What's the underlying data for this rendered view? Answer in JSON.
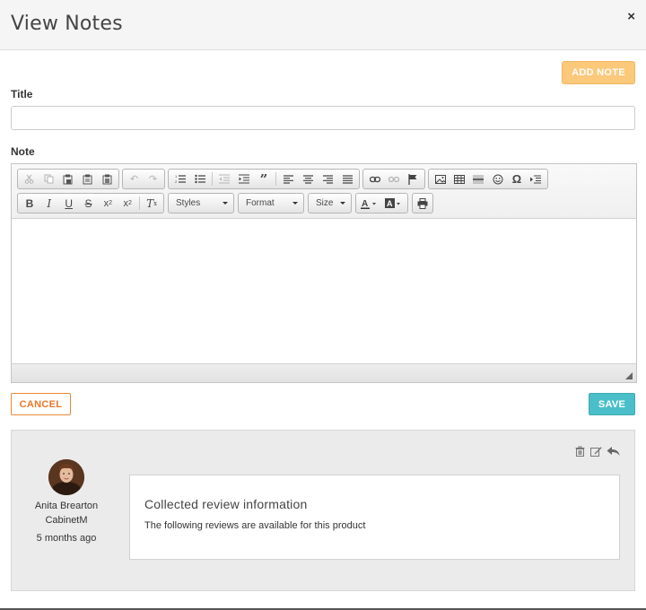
{
  "header": {
    "title": "View Notes",
    "close_glyph": "×"
  },
  "actions": {
    "add_note_label": "ADD NOTE",
    "cancel_label": "CANCEL",
    "save_label": "SAVE"
  },
  "form": {
    "title_label": "Title",
    "title_value": "",
    "note_label": "Note"
  },
  "editor": {
    "combos": {
      "styles": "Styles",
      "format": "Format",
      "size": "Size"
    },
    "icons": [
      "cut-icon",
      "copy-icon",
      "paste-icon",
      "paste-text-icon",
      "paste-word-icon",
      "undo-icon",
      "redo-icon",
      "numbered-list-icon",
      "bulleted-list-icon",
      "decrease-indent-icon",
      "increase-indent-icon",
      "blockquote-icon",
      "align-left-icon",
      "align-center-icon",
      "align-right-icon",
      "justify-icon",
      "link-icon",
      "unlink-icon",
      "anchor-icon",
      "image-icon",
      "table-icon",
      "horizontal-line-icon",
      "smiley-icon",
      "special-char-icon",
      "page-break-icon",
      "bold-icon",
      "italic-icon",
      "underline-icon",
      "strike-icon",
      "subscript-icon",
      "superscript-icon",
      "remove-format-icon",
      "text-color-icon",
      "bg-color-icon",
      "print-icon"
    ]
  },
  "note": {
    "author_name": "Anita Brearton",
    "author_company": "CabinetM",
    "time": "5 months ago",
    "title": "Collected review information",
    "body": "The following reviews are available for this product"
  },
  "colors": {
    "orange": "#e8782a",
    "teal": "#4bbfc9",
    "add_note": "#fcc87a"
  }
}
